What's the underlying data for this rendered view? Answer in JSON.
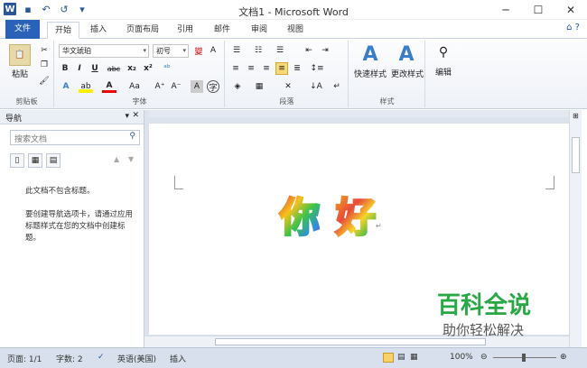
{
  "window": {
    "title": "文档1 - Microsoft Word",
    "minimize": "─",
    "maximize": "☐",
    "close": "✕"
  },
  "qat": {
    "undo": "↶",
    "redo": "↺",
    "more": "▾"
  },
  "tabs": [
    "文件",
    "开始",
    "插入",
    "页面布局",
    "引用",
    "邮件",
    "审阅",
    "视图"
  ],
  "ribbon": {
    "clipboard": {
      "label": "剪贴板",
      "paste": "粘贴"
    },
    "font": {
      "label": "字体",
      "name": "华文琥珀",
      "size": "初号",
      "bold": "B",
      "italic": "I",
      "underline": "U",
      "strike": "abc",
      "sub": "x₂",
      "sup": "x²",
      "grow": "A⁺",
      "shrink": "A⁻",
      "case": "Aa",
      "clear": "A"
    },
    "paragraph": {
      "label": "段落"
    },
    "styles": {
      "label": "样式",
      "quick": "快速样式",
      "change": "更改样式"
    },
    "editing": {
      "label": "编辑"
    }
  },
  "nav": {
    "title": "导航",
    "search_placeholder": "搜索文档",
    "no_headings": "此文档不包含标题。",
    "hint": "要创建导航选项卡，请通过应用标题样式在您的文档中创建标题。"
  },
  "document": {
    "text1": "你",
    "text2": "好",
    "mark": "↵"
  },
  "status": {
    "page": "页面: 1/1",
    "words": "字数: 2",
    "lang": "英语(美国)",
    "mode": "插入",
    "zoom": "100%"
  },
  "watermark": {
    "line1": "百科全说",
    "line2": "助你轻松解决"
  }
}
